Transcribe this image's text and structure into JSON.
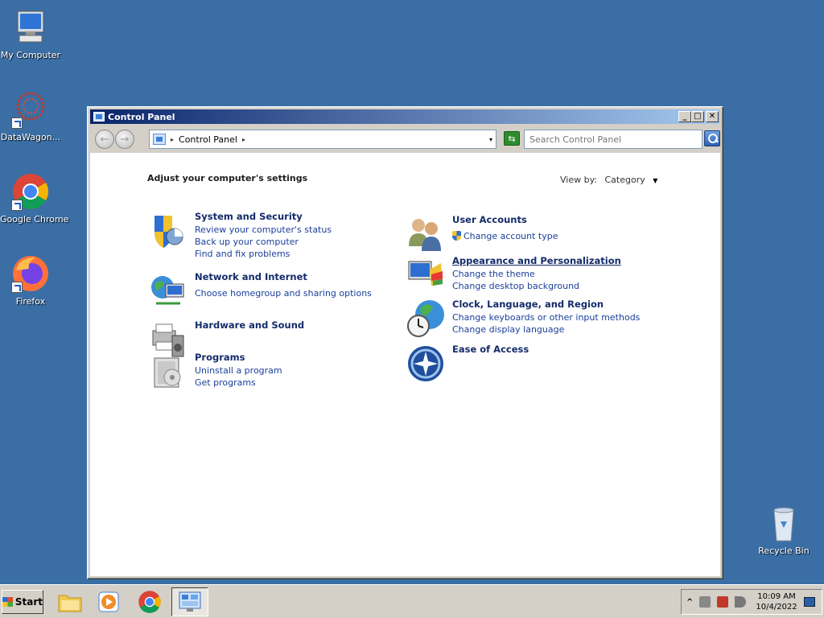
{
  "desktop": {
    "icons": [
      {
        "label": "My Computer"
      },
      {
        "label": "DataWagon..."
      },
      {
        "label": "Google Chrome"
      },
      {
        "label": "Firefox"
      },
      {
        "label": "Recycle Bin"
      }
    ]
  },
  "window": {
    "title": "Control Panel",
    "buttons": {
      "minimize": "_",
      "maximize": "□",
      "close": "✕"
    },
    "address": {
      "root_label": "Control Panel",
      "separator": "▸",
      "dropdown": "▾"
    },
    "search": {
      "placeholder": "Search Control Panel"
    },
    "heading": "Adjust your computer's settings",
    "view_by": {
      "label": "View by:",
      "mode": "Category",
      "arrow": "▼"
    },
    "categories_left": [
      {
        "title": "System and Security",
        "links": [
          "Review your computer's status",
          "Back up your computer",
          "Find and fix problems"
        ]
      },
      {
        "title": "Network and Internet",
        "links": [
          "Choose homegroup and sharing options"
        ]
      },
      {
        "title": "Hardware and Sound",
        "links": []
      },
      {
        "title": "Programs",
        "links": [
          "Uninstall a program",
          "Get programs"
        ]
      }
    ],
    "categories_right": [
      {
        "title": "User Accounts",
        "links": [
          "Change account type"
        ]
      },
      {
        "title": "Appearance and Personalization",
        "links": [
          "Change the theme",
          "Change desktop background"
        ]
      },
      {
        "title": "Clock, Language, and Region",
        "links": [
          "Change keyboards or other input methods",
          "Change display language"
        ]
      },
      {
        "title": "Ease of Access",
        "links": []
      }
    ]
  },
  "taskbar": {
    "start_label": "Start",
    "tray_chevron": "^",
    "time": "10:09 AM",
    "date": "10/4/2022"
  },
  "colors": {
    "desktop": "#3a6ea5",
    "title_gradient_start": "#0a246a",
    "link_blue": "#1a3e9a"
  }
}
